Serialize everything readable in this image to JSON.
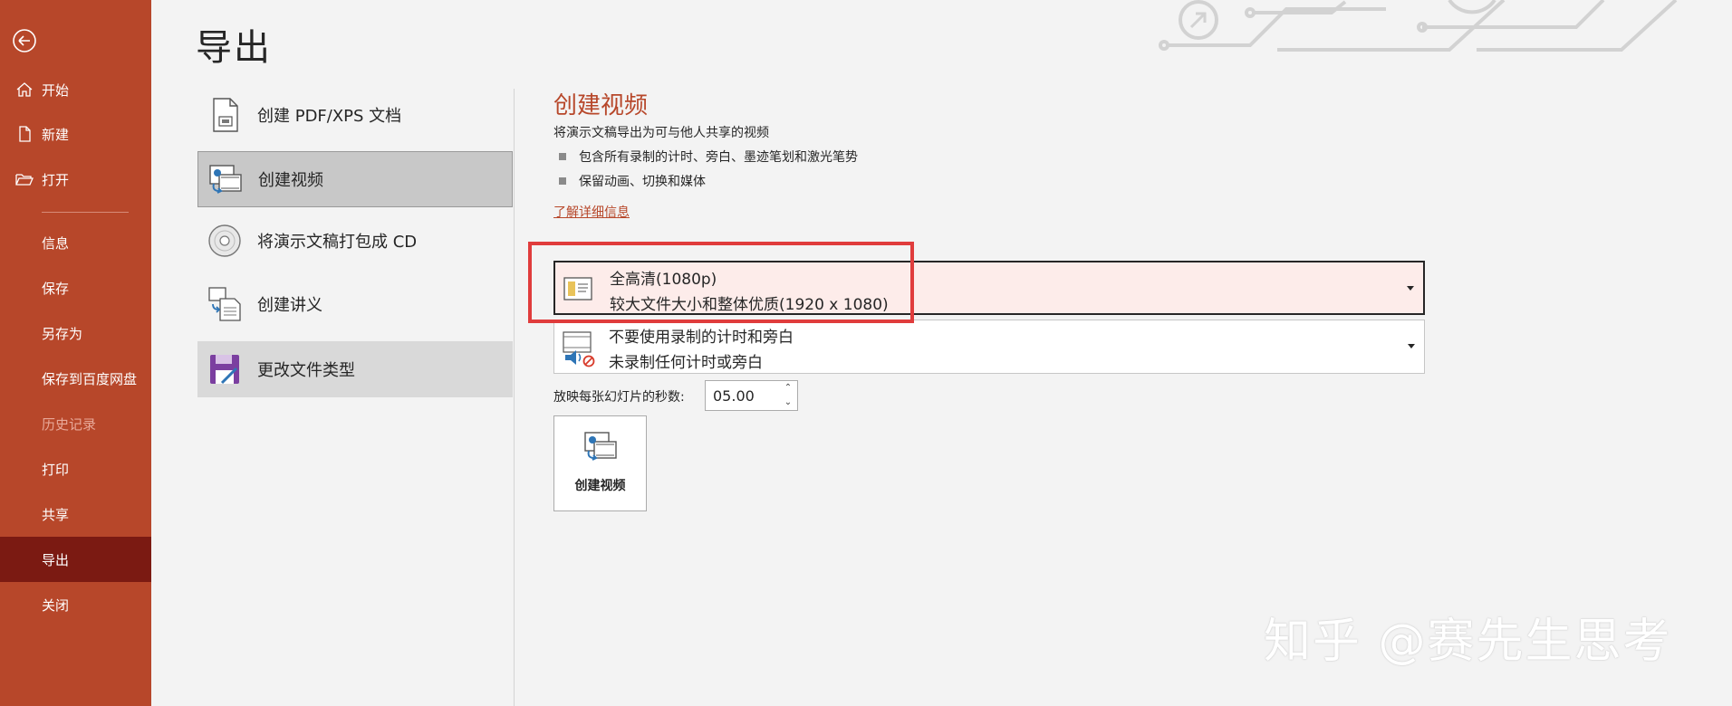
{
  "sidebar": {
    "back_icon": "back-arrow-icon",
    "items": [
      {
        "label": "开始",
        "icon": "home-icon"
      },
      {
        "label": "新建",
        "icon": "new-document-icon"
      },
      {
        "label": "打开",
        "icon": "open-folder-icon"
      },
      {
        "label": "信息"
      },
      {
        "label": "保存"
      },
      {
        "label": "另存为"
      },
      {
        "label": "保存到百度网盘"
      },
      {
        "label": "历史记录",
        "state": "disabled"
      },
      {
        "label": "打印"
      },
      {
        "label": "共享"
      },
      {
        "label": "导出",
        "state": "active"
      },
      {
        "label": "关闭"
      }
    ]
  },
  "page": {
    "title": "导出"
  },
  "options": [
    {
      "label": "创建 PDF/XPS 文档",
      "icon": "pdf-document-icon"
    },
    {
      "label": "创建视频",
      "icon": "video-icon",
      "state": "selected"
    },
    {
      "label": "将演示文稿打包成 CD",
      "icon": "cd-icon"
    },
    {
      "label": "创建讲义",
      "icon": "handout-icon"
    },
    {
      "label": "更改文件类型",
      "icon": "change-filetype-icon"
    }
  ],
  "detail": {
    "title": "创建视频",
    "description": "将演示文稿导出为可与他人共享的视频",
    "bullets": [
      "包含所有录制的计时、旁白、墨迹笔划和激光笔势",
      "保留动画、切换和媒体"
    ],
    "learn_more": "了解详细信息",
    "quality": {
      "line1": "全高清(1080p)",
      "line2": "较大文件大小和整体优质(1920 x 1080)",
      "icon": "quality-slide-icon"
    },
    "timing": {
      "line1": "不要使用录制的计时和旁白",
      "line2": "未录制任何计时或旁白",
      "icon": "no-narration-icon"
    },
    "seconds_label": "放映每张幻灯片的秒数:",
    "seconds_value": "05.00",
    "create_button": "创建视频"
  },
  "watermark": "知乎 @赛先生思考",
  "colors": {
    "brand": "#b7472a",
    "active_nav": "#7b1a12",
    "highlight": "#e03c3c"
  }
}
